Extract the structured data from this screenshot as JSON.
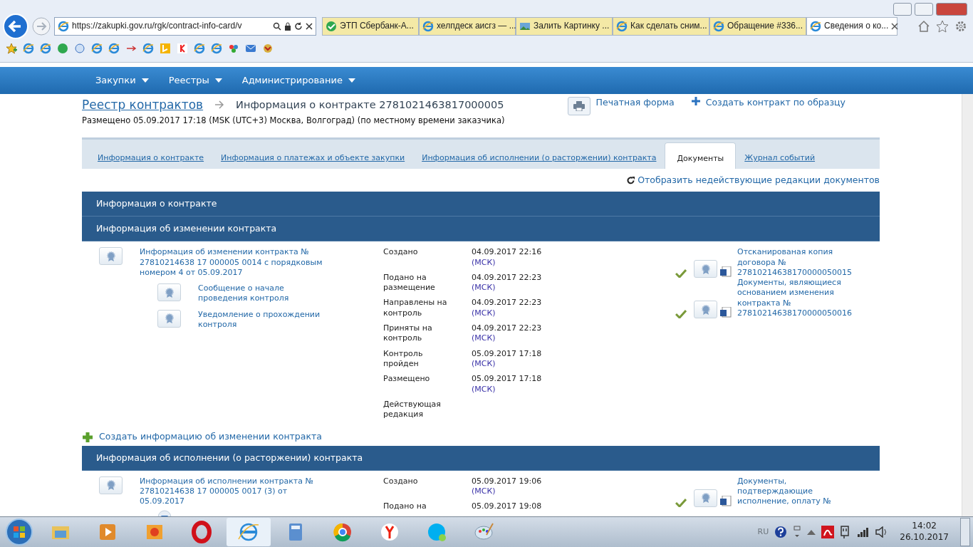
{
  "browser": {
    "address": "https://zakupki.gov.ru/rgk/contract-info-card/v",
    "tabs": [
      {
        "label": "ЭТП Сбербанк-А...",
        "kind": "sber",
        "selected": false
      },
      {
        "label": "хелпдеск аисгз — ...",
        "kind": "ie",
        "selected": false
      },
      {
        "label": "Залить Картинку ...",
        "kind": "image",
        "selected": false
      },
      {
        "label": "Как сделать сним...",
        "kind": "ie",
        "selected": false
      },
      {
        "label": "Обращение #336...",
        "kind": "ie",
        "selected": false
      },
      {
        "label": "Сведения о ко...",
        "kind": "ie",
        "selected": true
      }
    ]
  },
  "menu": [
    {
      "label": "Закупки"
    },
    {
      "label": "Реестры"
    },
    {
      "label": "Администрирование"
    }
  ],
  "breadcrumb": {
    "link": "Реестр контрактов",
    "title": "Информация о контракте 2781021463817000005"
  },
  "placed_note": "Размещено 05.09.2017 17:18 (MSK (UTC+3) Москва, Волгоград) (по местному времени заказчика)",
  "actions": [
    {
      "label": "Печатная форма",
      "kind": "print"
    },
    {
      "label": "Создать контракт по образцу",
      "kind": "plus"
    }
  ],
  "tabs": [
    {
      "label": "Информация о контракте",
      "selected": false
    },
    {
      "label": "Информация о платежах и объекте закупки",
      "selected": false
    },
    {
      "label": "Информация об исполнении (о расторжении) контракта",
      "selected": false
    },
    {
      "label": "Документы",
      "selected": true
    },
    {
      "label": "Журнал событий",
      "selected": false
    }
  ],
  "show_inactive_link": "Отобразить недействующие редакции документов",
  "sections": [
    {
      "title": "Информация о контракте"
    },
    {
      "title": "Информация об изменении контракта",
      "items": [
        {
          "document": "Информация об изменении контракта № 27810214638 17 000005 0014 с порядковым номером 4 от 05.09.2017",
          "expand": false,
          "subdocuments": [
            "Сообщение о начале проведения контроля",
            "Уведомление о прохождении контроля"
          ],
          "events": [
            {
              "label": "Создано",
              "date": "04.09.2017 22:16",
              "tz": "(МСК)"
            },
            {
              "label": "Подано на размещение",
              "date": "04.09.2017 22:23",
              "tz": "(МСК)"
            },
            {
              "label": "Направлены на контроль",
              "date": "04.09.2017 22:23",
              "tz": "(МСК)"
            },
            {
              "label": "Приняты на контроль",
              "date": "04.09.2017 22:23",
              "tz": "(МСК)"
            },
            {
              "label": "Контроль пройден",
              "date": "05.09.2017 17:18",
              "tz": "(МСК)"
            },
            {
              "label": "Размещено",
              "date": "05.09.2017 17:18",
              "tz": "(МСК)"
            },
            {
              "label": "Действующая редакция"
            }
          ],
          "attachments": [
            {
              "text": "Отсканированая копия договора № 27810214638170000050015",
              "checked": true
            },
            {
              "text": "Документы, являющиеся основанием изменения контракта № 27810214638170000050016",
              "checked": true
            }
          ]
        }
      ],
      "create_link": "Создать информацию об изменении контракта"
    },
    {
      "title": "Информация об исполнении (о расторжении) контракта",
      "items": [
        {
          "document": "Информация об исполнении контракта № 27810214638 17 000005 0017 (3) от 05.09.2017",
          "expand": true,
          "events": [
            {
              "label": "Создано",
              "date": "05.09.2017 19:06",
              "tz": "(МСК)"
            },
            {
              "label": "Подано на",
              "date": "05.09.2017 19:08"
            }
          ],
          "attachments": [
            {
              "text": "Документы, подтверждающие исполнение, оплату №",
              "checked": true
            }
          ]
        }
      ]
    }
  ],
  "taskbar": {
    "apps": [
      {
        "kind": "folder",
        "selected": false
      },
      {
        "kind": "player",
        "selected": false
      },
      {
        "kind": "photos",
        "selected": false
      },
      {
        "kind": "opera",
        "selected": false
      },
      {
        "kind": "ie",
        "selected": true
      },
      {
        "kind": "calculator",
        "selected": false
      },
      {
        "kind": "chrome",
        "selected": false
      },
      {
        "kind": "yandex",
        "selected": false
      },
      {
        "kind": "skype",
        "selected": false
      },
      {
        "kind": "paint",
        "selected": false
      }
    ],
    "language": "RU",
    "time": "14:02",
    "date": "26.10.2017"
  }
}
